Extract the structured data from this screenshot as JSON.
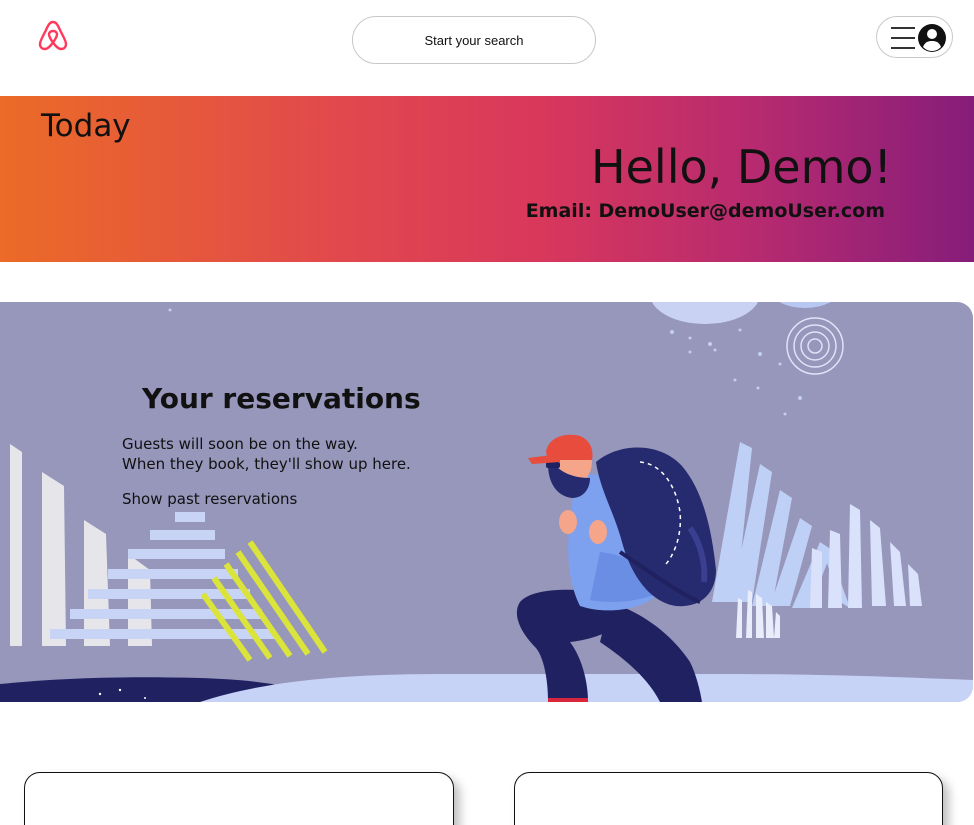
{
  "header": {
    "logo_icon": "airbnb-logo-icon",
    "search_label": "Start your search",
    "menu_icon": "hamburger-menu-icon",
    "avatar_icon": "user-avatar-icon"
  },
  "banner": {
    "today_label": "Today",
    "greeting": "Hello, Demo!",
    "email_line": "Email: DemoUser@demoUser.com",
    "gradient_colors": [
      "#eb6b27",
      "#e1484d",
      "#d9385b",
      "#b62a70",
      "#861d7a"
    ]
  },
  "reservations": {
    "title": "Your reservations",
    "description_line1": "Guests will soon be on the way.",
    "description_line2": "When they book, they'll show up here.",
    "past_link": "Show past reservations",
    "background_color": "#9796bb"
  },
  "colors": {
    "brand": "#ff385c",
    "text": "#111111"
  }
}
